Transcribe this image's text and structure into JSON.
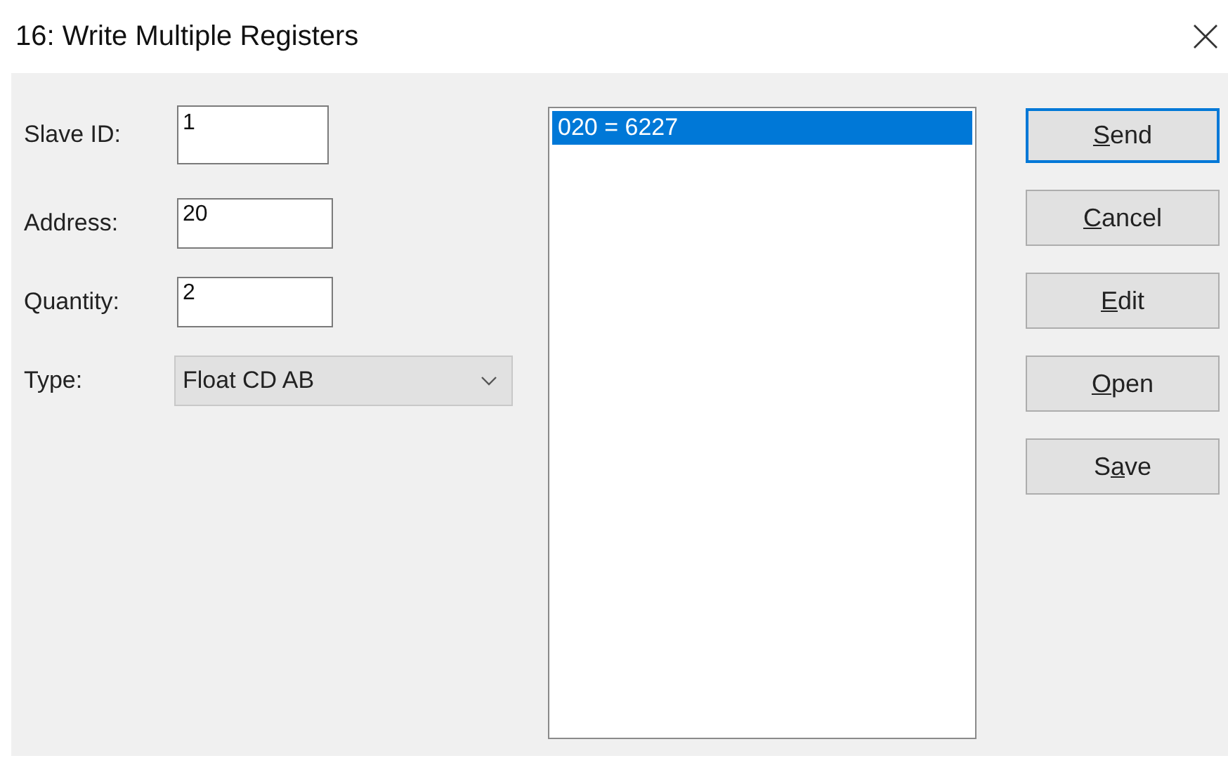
{
  "window": {
    "title": "16: Write Multiple Registers"
  },
  "fields": [
    {
      "label": "Slave ID:",
      "value": "1"
    },
    {
      "label": "Address:",
      "value": "20"
    },
    {
      "label": "Quantity:",
      "value": "2"
    }
  ],
  "type_select": {
    "label": "Type:",
    "value": "Float CD AB"
  },
  "register_list": [
    {
      "text": "020 = 6227",
      "selected": true
    }
  ],
  "buttons": [
    {
      "access_key": "S",
      "label_rest": "end",
      "focused": true
    },
    {
      "access_key": "C",
      "label_rest": "ancel",
      "focused": false
    },
    {
      "access_key": "E",
      "label_rest": "dit",
      "focused": false
    },
    {
      "access_key": "O",
      "label_rest": "pen",
      "focused": false
    },
    {
      "label_start": "S",
      "access_key": "a",
      "label_rest": "ve",
      "focused": false
    }
  ]
}
